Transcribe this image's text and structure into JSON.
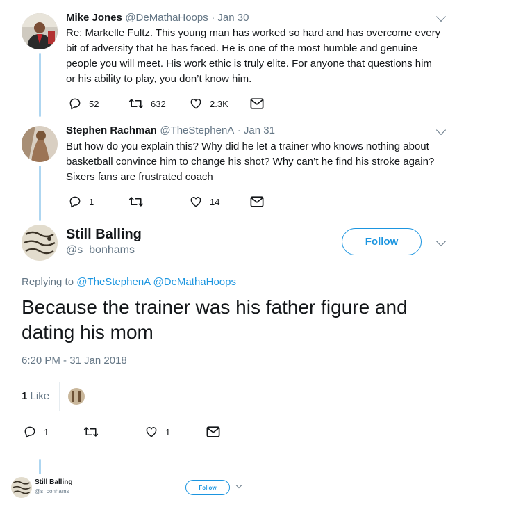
{
  "tweets": [
    {
      "name": "Mike Jones",
      "handle": "@DeMathaHoops",
      "date": "· Jan 30",
      "text": "Re: Markelle Fultz. This young man has worked so hard and has overcome every bit of adversity that he has faced. He is one of the most humble and genuine people you will meet. His work ethic is truly elite. For anyone that questions him or his ability to play, you don’t know him.",
      "replies": "52",
      "retweets": "632",
      "likes": "2.3K"
    },
    {
      "name": "Stephen Rachman",
      "handle": "@TheStephenA",
      "date": "· Jan 31",
      "text": "But how do you explain this? Why did he let a trainer who knows nothing about basketball convince him to change his shot? Why can’t he find his stroke again? Sixers fans are frustrated coach",
      "replies": "1",
      "retweets": "",
      "likes": "14"
    }
  ],
  "main_tweet": {
    "name": "Still Balling",
    "handle": "@s_bonhams",
    "follow_label": "Follow",
    "replying_prefix": "Replying to",
    "replying_to": [
      "@TheStephenA",
      "@DeMathaHoops"
    ],
    "text": "Because the trainer was his father figure and dating his mom",
    "timestamp": "6:20 PM - 31 Jan 2018",
    "like_count": "1",
    "like_label": "Like",
    "replies": "1",
    "retweets": "",
    "likes": "1"
  },
  "bottom_profile": {
    "name": "Still Balling",
    "handle": "@s_bonhams",
    "follow_label": "Follow"
  },
  "colors": {
    "accent": "#1b95e0",
    "thread_line": "#aed6f1",
    "muted": "#657786",
    "text": "#14171a"
  },
  "icons": [
    "reply-icon",
    "retweet-icon",
    "heart-icon",
    "mail-icon",
    "chevron-down-icon"
  ]
}
